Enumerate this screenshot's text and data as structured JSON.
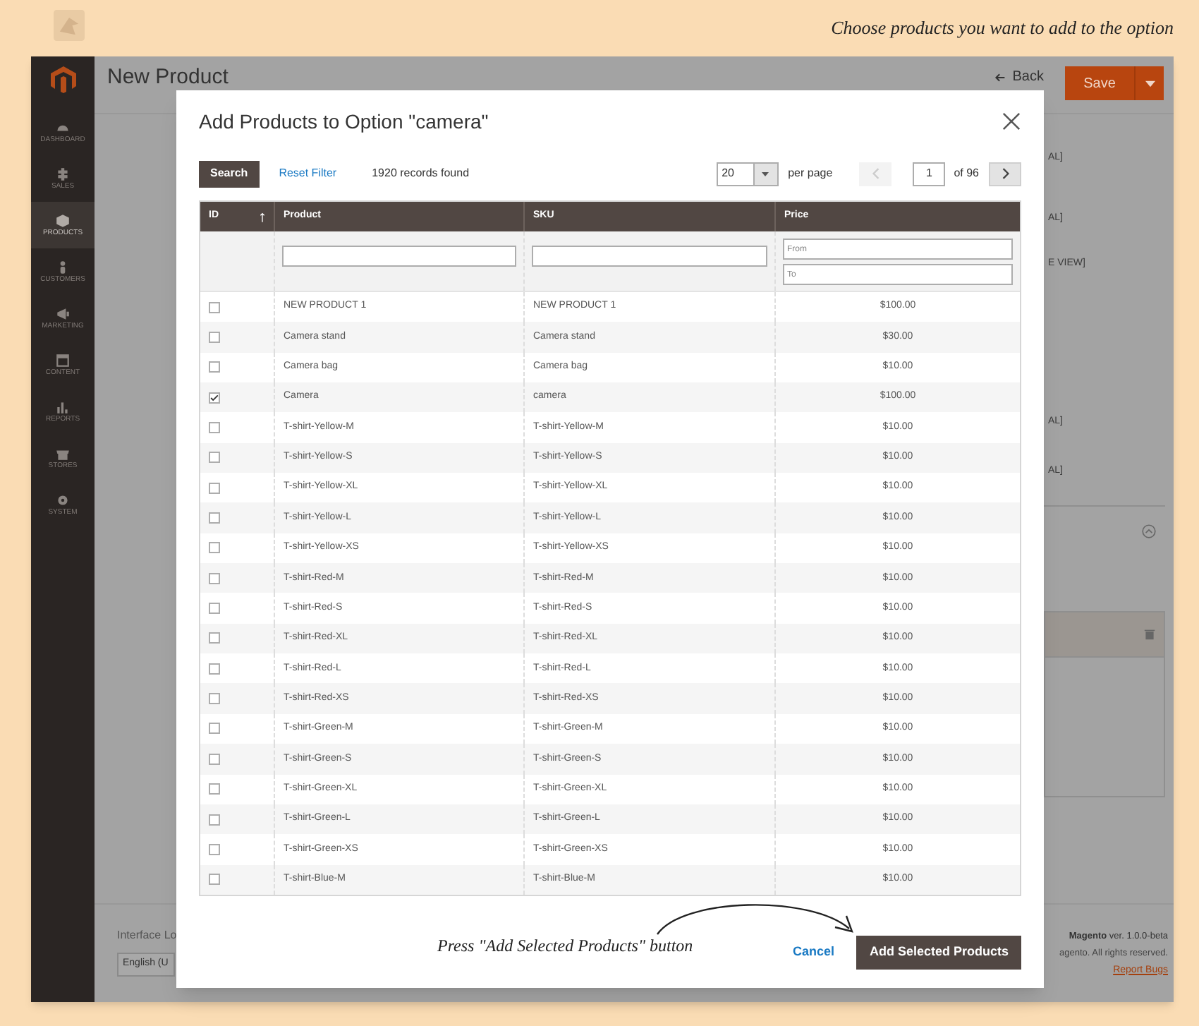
{
  "caption": "Choose products you want to add to the option",
  "sidebar": {
    "items": [
      {
        "label": "DASHBOARD",
        "selected": false
      },
      {
        "label": "SALES",
        "selected": false
      },
      {
        "label": "PRODUCTS",
        "selected": true
      },
      {
        "label": "CUSTOMERS",
        "selected": false
      },
      {
        "label": "MARKETING",
        "selected": false
      },
      {
        "label": "CONTENT",
        "selected": false
      },
      {
        "label": "REPORTS",
        "selected": false
      },
      {
        "label": "STORES",
        "selected": false
      },
      {
        "label": "SYSTEM",
        "selected": false
      }
    ]
  },
  "page": {
    "title": "New Product",
    "back": "Back",
    "save": "Save",
    "fragments": [
      "AL]",
      "AL]",
      "E VIEW]",
      "AL]",
      "AL]"
    ],
    "footer": {
      "locale_label": "Interface Lo",
      "locale_value": "English (U",
      "version": "**Magento** ver. 1.0.0-beta",
      "copyright": "agento. All rights reserved.",
      "report": "Report Bugs"
    }
  },
  "modal": {
    "title": "Add Products to Option \"camera\"",
    "search": "Search",
    "reset": "Reset Filter",
    "records": "1920 records found",
    "per_page_value": "20",
    "per_page": "per page",
    "prev": {
      "disabled": true
    },
    "next": {
      "disabled": false
    },
    "page": "1",
    "of": "of 96",
    "columns": [
      {
        "label": "ID",
        "sorted": true
      },
      {
        "label": "Product",
        "sorted": false
      },
      {
        "label": "SKU",
        "sorted": false
      },
      {
        "label": "Price",
        "sorted": false
      }
    ],
    "filters": {
      "price_from": {
        "placeholder": "From"
      },
      "price_to": {
        "placeholder": "To"
      }
    },
    "rows": [
      {
        "checked": false,
        "product": "NEW PRODUCT 1",
        "sku": "NEW PRODUCT 1",
        "price": "$100.00"
      },
      {
        "checked": false,
        "product": "Camera stand",
        "sku": "Camera stand",
        "price": "$30.00"
      },
      {
        "checked": false,
        "product": "Camera bag",
        "sku": "Camera bag",
        "price": "$10.00"
      },
      {
        "checked": true,
        "product": "Camera",
        "sku": "camera",
        "price": "$100.00"
      },
      {
        "checked": false,
        "product": "T-shirt-Yellow-M",
        "sku": "T-shirt-Yellow-M",
        "price": "$10.00"
      },
      {
        "checked": false,
        "product": "T-shirt-Yellow-S",
        "sku": "T-shirt-Yellow-S",
        "price": "$10.00"
      },
      {
        "checked": false,
        "product": "T-shirt-Yellow-XL",
        "sku": "T-shirt-Yellow-XL",
        "price": "$10.00"
      },
      {
        "checked": false,
        "product": "T-shirt-Yellow-L",
        "sku": "T-shirt-Yellow-L",
        "price": "$10.00"
      },
      {
        "checked": false,
        "product": "T-shirt-Yellow-XS",
        "sku": "T-shirt-Yellow-XS",
        "price": "$10.00"
      },
      {
        "checked": false,
        "product": "T-shirt-Red-M",
        "sku": "T-shirt-Red-M",
        "price": "$10.00"
      },
      {
        "checked": false,
        "product": "T-shirt-Red-S",
        "sku": "T-shirt-Red-S",
        "price": "$10.00"
      },
      {
        "checked": false,
        "product": "T-shirt-Red-XL",
        "sku": "T-shirt-Red-XL",
        "price": "$10.00"
      },
      {
        "checked": false,
        "product": "T-shirt-Red-L",
        "sku": "T-shirt-Red-L",
        "price": "$10.00"
      },
      {
        "checked": false,
        "product": "T-shirt-Red-XS",
        "sku": "T-shirt-Red-XS",
        "price": "$10.00"
      },
      {
        "checked": false,
        "product": "T-shirt-Green-M",
        "sku": "T-shirt-Green-M",
        "price": "$10.00"
      },
      {
        "checked": false,
        "product": "T-shirt-Green-S",
        "sku": "T-shirt-Green-S",
        "price": "$10.00"
      },
      {
        "checked": false,
        "product": "T-shirt-Green-XL",
        "sku": "T-shirt-Green-XL",
        "price": "$10.00"
      },
      {
        "checked": false,
        "product": "T-shirt-Green-L",
        "sku": "T-shirt-Green-L",
        "price": "$10.00"
      },
      {
        "checked": false,
        "product": "T-shirt-Green-XS",
        "sku": "T-shirt-Green-XS",
        "price": "$10.00"
      },
      {
        "checked": false,
        "product": "T-shirt-Blue-M",
        "sku": "T-shirt-Blue-M",
        "price": "$10.00"
      }
    ],
    "cancel": "Cancel",
    "add": "Add Selected Products"
  },
  "annotation": "Press \"Add Selected Products\" button"
}
